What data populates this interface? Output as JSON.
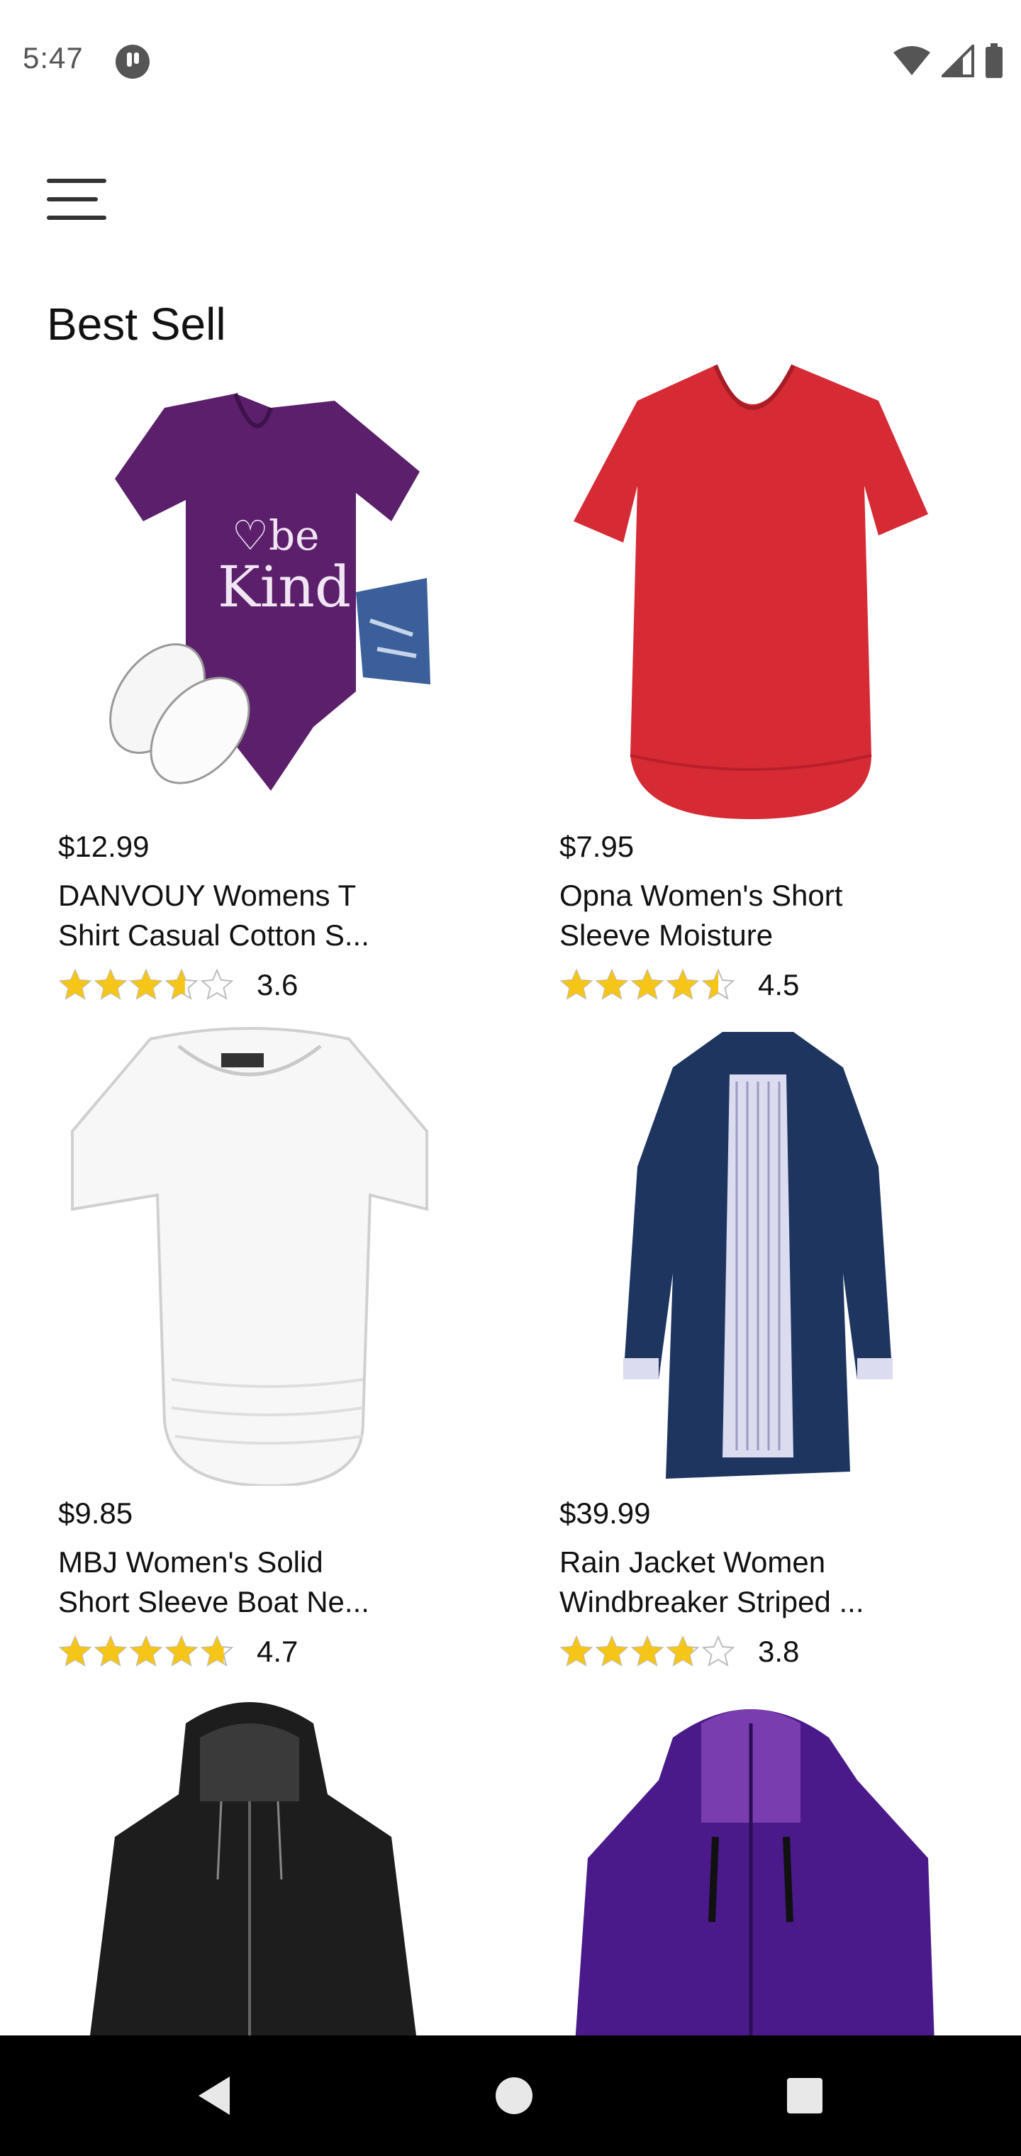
{
  "status_bar": {
    "time": "5:47",
    "icons": [
      "app-icon",
      "wifi-icon",
      "signal-icon",
      "battery-icon"
    ]
  },
  "header": {
    "menu_icon": "menu-icon",
    "title": "Best Sell"
  },
  "colors": {
    "star": "#F5C518",
    "star_outline": "#BDBDBD",
    "nav_bar": "#000000",
    "text": "#111111"
  },
  "products": [
    {
      "price": "$12.99",
      "name_line1": "DANVOUY Womens T",
      "name_line2": "Shirt Casual Cotton S...",
      "rating": 3.6,
      "rating_text": "3.6",
      "image": "purple-be-kind-tshirt"
    },
    {
      "price": "$7.95",
      "name_line1": "Opna Women's Short",
      "name_line2": "Sleeve Moisture",
      "rating": 4.5,
      "rating_text": "4.5",
      "image": "red-vneck-tshirt"
    },
    {
      "price": "$9.85",
      "name_line1": "MBJ Women's Solid",
      "name_line2": "Short Sleeve Boat Ne...",
      "rating": 4.7,
      "rating_text": "4.7",
      "image": "white-boat-neck-top"
    },
    {
      "price": "$39.99",
      "name_line1": "Rain Jacket Women",
      "name_line2": "Windbreaker Striped ...",
      "rating": 3.8,
      "rating_text": "3.8",
      "image": "navy-rain-jacket"
    },
    {
      "price": "",
      "name_line1": "",
      "name_line2": "",
      "rating": null,
      "rating_text": "",
      "image": "black-leather-jacket"
    },
    {
      "price": "",
      "name_line1": "",
      "name_line2": "",
      "rating": null,
      "rating_text": "",
      "image": "purple-outdoor-jacket"
    }
  ],
  "nav_bar": {
    "buttons": [
      "back-icon",
      "home-icon",
      "recents-icon"
    ]
  }
}
